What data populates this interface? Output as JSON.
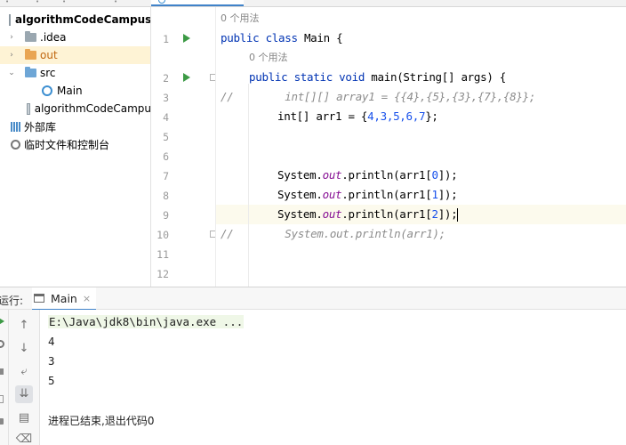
{
  "project_tree": {
    "root": "algorithmCodeCampus",
    "items": [
      {
        "label": ".idea"
      },
      {
        "label": "out"
      },
      {
        "label": "src"
      },
      {
        "label": "Main"
      },
      {
        "label": "algorithmCodeCampu"
      },
      {
        "label": "外部库"
      },
      {
        "label": "临时文件和控制台"
      }
    ]
  },
  "editor": {
    "usage_hint_class": "0 个用法",
    "usage_hint_method": "0 个用法",
    "line_numbers": [
      "1",
      "2",
      "3",
      "4",
      "5",
      "6",
      "7",
      "8",
      "9",
      "10",
      "11",
      "12"
    ],
    "lines": {
      "l1_kw": "public class",
      "l1_rest": " Main {",
      "l2_kw": "public static void",
      "l2_rest": " main(String[] args) {",
      "l3_marker": "//",
      "l3_text": "        int[][] array1 = {{4},{5},{3},{7},{8}};",
      "l4_pre": "int[] arr1 = {",
      "l4_nums": "4,3,5,6,7",
      "l4_post": "};",
      "l7_pre": "System.",
      "l7_field": "out",
      "l7_call": ".println(arr1[",
      "l7_idx": "0",
      "l7_end": "]);",
      "l8_pre": "System.",
      "l8_field": "out",
      "l8_call": ".println(arr1[",
      "l8_idx": "1",
      "l8_end": "]);",
      "l9_pre": "System.",
      "l9_field": "out",
      "l9_call": ".println(arr1[",
      "l9_idx": "2",
      "l9_end": "]);",
      "l10_marker": "//",
      "l10_text": "        System.out.println(arr1);"
    }
  },
  "run_panel": {
    "label": "运行:",
    "tab_label": "Main",
    "close_glyph": "×",
    "console": {
      "command": "E:\\Java\\jdk8\\bin\\java.exe ...",
      "outputs": [
        "4",
        "3",
        "5"
      ],
      "exit_message": "进程已结束,退出代码0"
    }
  },
  "colors": {
    "keyword": "#0033b3",
    "comment": "#8c8c8c",
    "field": "#871094",
    "number": "#1750eb",
    "run_green": "#3c9a45",
    "selection": "#fef3d5",
    "accent": "#4083c9"
  },
  "icons": [
    "folder-icon",
    "class-icon",
    "module-icon",
    "library-icon",
    "scratch-icon",
    "run-icon",
    "fold-icon",
    "console-icon",
    "close-icon",
    "arrow-up-icon",
    "arrow-down-icon",
    "soft-wrap-icon",
    "scroll-to-end-icon",
    "print-icon"
  ]
}
